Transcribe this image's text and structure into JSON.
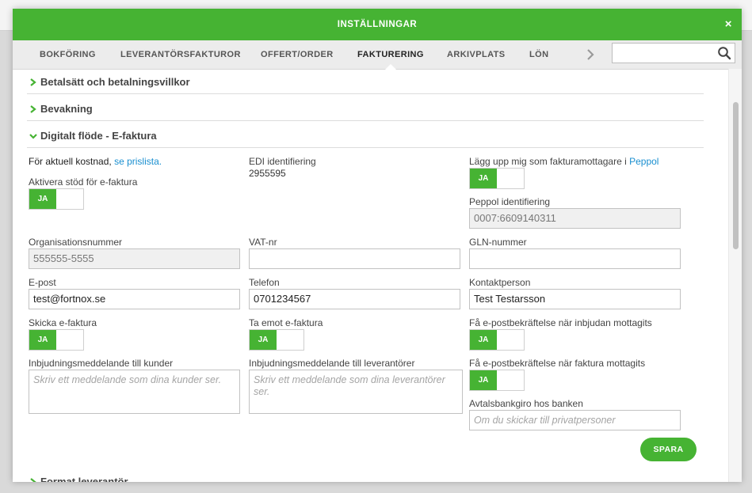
{
  "modal": {
    "title": "INSTÄLLNINGAR",
    "close_label": "×"
  },
  "tabs": [
    {
      "label": "BOKFÖRING"
    },
    {
      "label": "LEVERANTÖRSFAKTUROR"
    },
    {
      "label": "OFFERT/ORDER"
    },
    {
      "label": "FAKTURERING",
      "active": true
    },
    {
      "label": "ARKIVPLATS"
    },
    {
      "label": "LÖN"
    }
  ],
  "search": {
    "value": ""
  },
  "sections": {
    "payment": "Betalsätt och betalningsvillkor",
    "monitoring": "Bevakning",
    "digital": "Digitalt flöde - E-faktura",
    "next": "Format leverantör"
  },
  "form": {
    "cost_text": "För aktuell kostnad, ",
    "cost_link": "se prislista.",
    "activate_label": "Aktivera stöd för e-faktura",
    "activate_toggle": "JA",
    "edi_label": "EDI identifiering",
    "edi_value": "2955595",
    "peppol_register_text": "Lägg upp mig som fakturamottagare i ",
    "peppol_link": "Peppol",
    "peppol_register_toggle": "JA",
    "peppol_id_label": "Peppol identifiering",
    "peppol_id_value": "0007:6609140311",
    "org_label": "Organisationsnummer",
    "org_value": "555555-5555",
    "vat_label": "VAT-nr",
    "vat_value": "",
    "gln_label": "GLN-nummer",
    "gln_value": "",
    "email_label": "E-post",
    "email_value": "test@fortnox.se",
    "phone_label": "Telefon",
    "phone_value": "0701234567",
    "contact_label": "Kontaktperson",
    "contact_value": "Test Testarsson",
    "send_label": "Skicka e-faktura",
    "send_toggle": "JA",
    "receive_label": "Ta emot e-faktura",
    "receive_toggle": "JA",
    "confirm_invite_label": "Få e-postbekräftelse när inbjudan mottagits",
    "confirm_invite_toggle": "JA",
    "invite_customers_label": "Inbjudningsmeddelande till kunder",
    "invite_customers_placeholder": "Skriv ett meddelande som dina kunder ser.",
    "invite_suppliers_label": "Inbjudningsmeddelande till leverantörer",
    "invite_suppliers_placeholder": "Skriv ett meddelande som dina leverantörer ser.",
    "confirm_invoice_label": "Få e-postbekräftelse när faktura mottagits",
    "confirm_invoice_toggle": "JA",
    "bankgiro_label": "Avtalsbankgiro hos banken",
    "bankgiro_placeholder": "Om du skickar till privatpersoner",
    "save_label": "SPARA"
  },
  "colors": {
    "brand_green": "#46b333",
    "link_blue": "#1a8fd0"
  }
}
